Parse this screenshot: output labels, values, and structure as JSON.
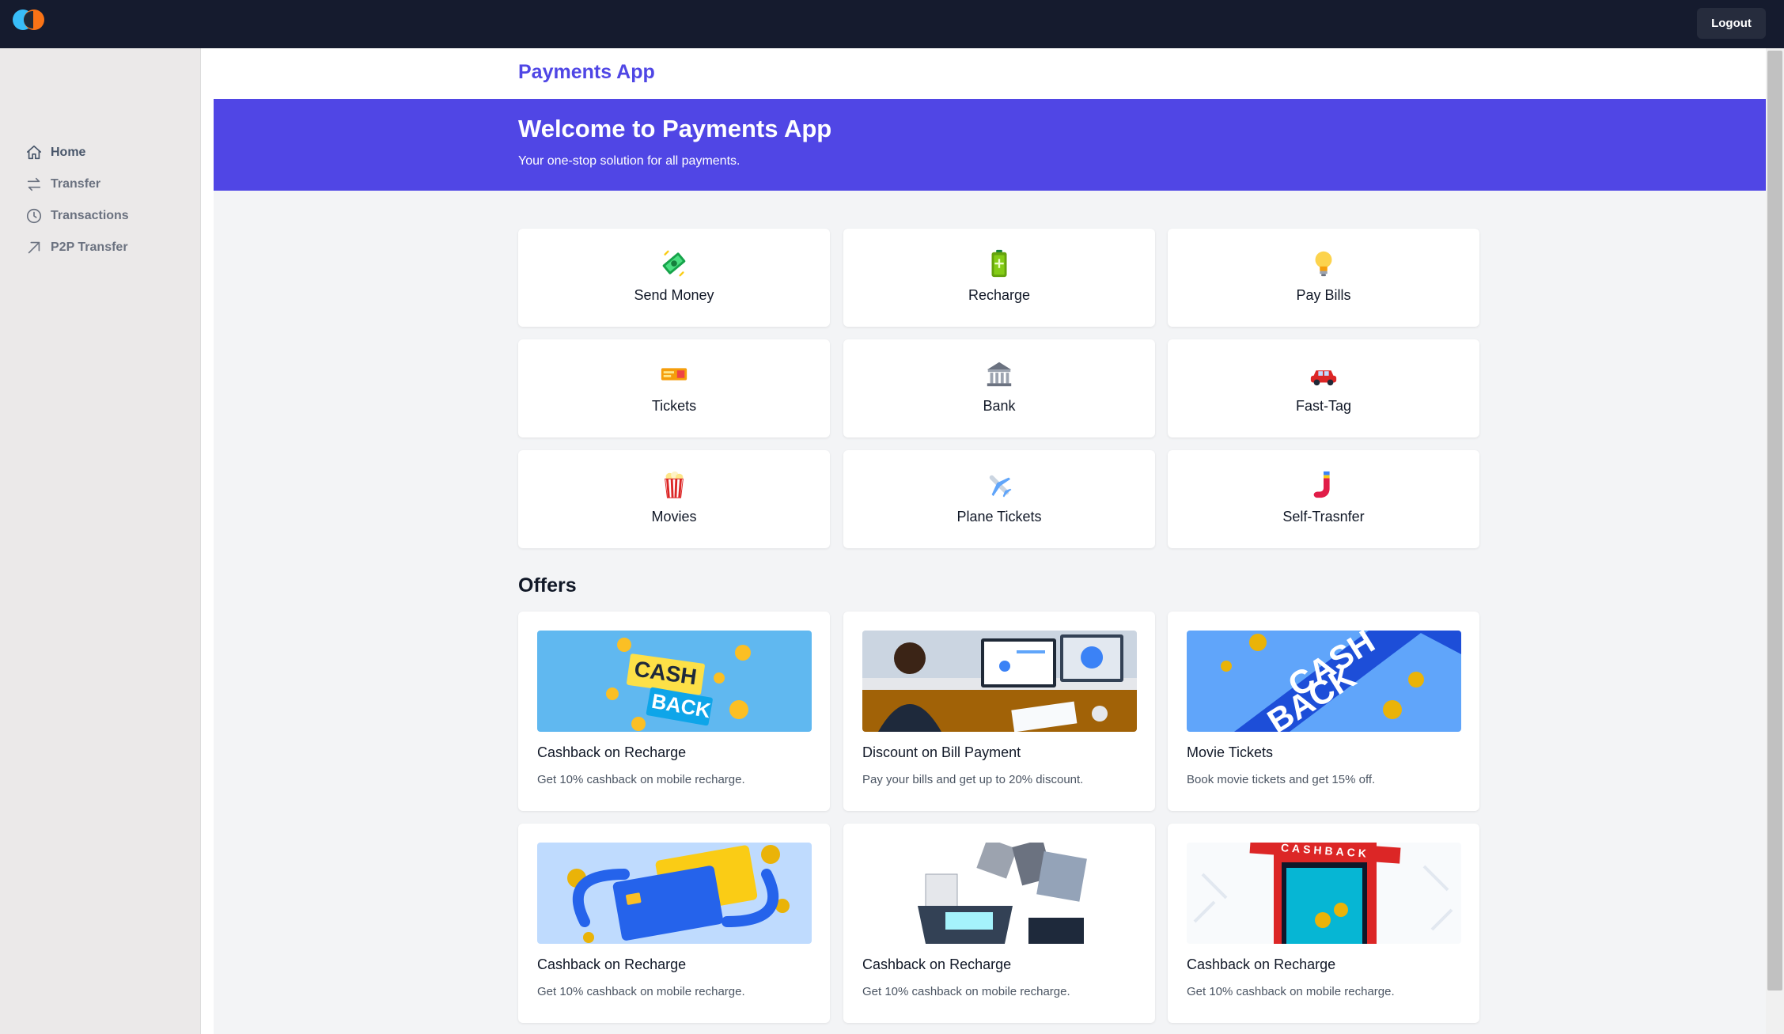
{
  "topbar": {
    "logout_label": "Logout"
  },
  "sidebar": {
    "items": [
      {
        "label": "Home",
        "icon": "home-icon"
      },
      {
        "label": "Transfer",
        "icon": "arrows-icon"
      },
      {
        "label": "Transactions",
        "icon": "clock-icon"
      },
      {
        "label": "P2P Transfer",
        "icon": "arrow-up-right-icon"
      }
    ]
  },
  "header": {
    "app_title": "Payments App"
  },
  "hero": {
    "title": "Welcome to Payments App",
    "subtitle": "Your one-stop solution for all payments."
  },
  "services": [
    {
      "label": "Send Money",
      "icon": "money-icon"
    },
    {
      "label": "Recharge",
      "icon": "battery-icon"
    },
    {
      "label": "Pay Bills",
      "icon": "lightbulb-icon"
    },
    {
      "label": "Tickets",
      "icon": "ticket-icon"
    },
    {
      "label": "Bank",
      "icon": "bank-icon"
    },
    {
      "label": "Fast-Tag",
      "icon": "car-icon"
    },
    {
      "label": "Movies",
      "icon": "popcorn-icon"
    },
    {
      "label": "Plane Tickets",
      "icon": "airplane-icon"
    },
    {
      "label": "Self-Trasnfer",
      "icon": "sock-icon"
    }
  ],
  "offers": {
    "title": "Offers",
    "items": [
      {
        "title": "Cashback on Recharge",
        "description": "Get 10% cashback on mobile recharge.",
        "image_text": [
          "CASH",
          "BACK"
        ]
      },
      {
        "title": "Discount on Bill Payment",
        "description": "Pay your bills and get up to 20% discount."
      },
      {
        "title": "Movie Tickets",
        "description": "Book movie tickets and get 15% off.",
        "image_text": [
          "CASH",
          "BACK"
        ]
      },
      {
        "title": "Cashback on Recharge",
        "description": "Get 10% cashback on mobile recharge."
      },
      {
        "title": "Cashback on Recharge",
        "description": "Get 10% cashback on mobile recharge."
      },
      {
        "title": "Cashback on Recharge",
        "description": "Get 10% cashback on mobile recharge.",
        "image_text": [
          "CASHBACK"
        ]
      }
    ]
  },
  "colors": {
    "topbar": "#151b2e",
    "accent": "#5046e5",
    "sidebar": "#ebe9e9",
    "background": "#f3f4f6"
  }
}
